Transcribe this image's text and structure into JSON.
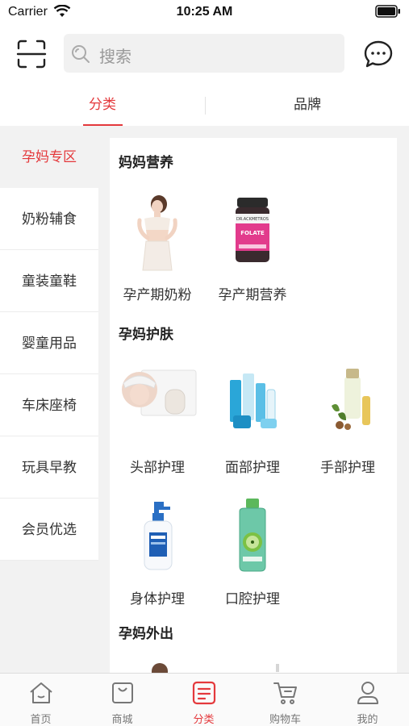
{
  "status_bar": {
    "carrier": "Carrier",
    "time": "10:25 AM"
  },
  "search": {
    "placeholder": "搜索"
  },
  "tabs": [
    {
      "label": "分类"
    },
    {
      "label": "品牌"
    }
  ],
  "sidebar": {
    "items": [
      {
        "label": "孕妈专区"
      },
      {
        "label": "奶粉辅食"
      },
      {
        "label": "童装童鞋"
      },
      {
        "label": "婴童用品"
      },
      {
        "label": "车床座椅"
      },
      {
        "label": "玩具早教"
      },
      {
        "label": "会员优选"
      }
    ]
  },
  "content": {
    "sections": [
      {
        "title": "妈妈营养",
        "items": [
          {
            "label": "孕产期奶粉"
          },
          {
            "label": "孕产期营养"
          }
        ]
      },
      {
        "title": "孕妈护肤",
        "items": [
          {
            "label": "头部护理"
          },
          {
            "label": "面部护理"
          },
          {
            "label": "手部护理"
          },
          {
            "label": "身体护理"
          },
          {
            "label": "口腔护理"
          }
        ]
      },
      {
        "title": "孕妈外出",
        "items": []
      }
    ],
    "product_image_text": {
      "supplement_brand": "DR.ACKMETROS",
      "supplement_name": "FOLATE"
    }
  },
  "bottom_nav": {
    "items": [
      {
        "label": "首页",
        "icon": "home-icon"
      },
      {
        "label": "商城",
        "icon": "shopping-bag-icon"
      },
      {
        "label": "分类",
        "icon": "category-list-icon"
      },
      {
        "label": "购物车",
        "icon": "cart-icon"
      },
      {
        "label": "我的",
        "icon": "user-icon"
      }
    ]
  },
  "colors": {
    "accent": "#e4393c",
    "panel_bg": "#f2f2f2",
    "inactive_text": "#333333"
  }
}
